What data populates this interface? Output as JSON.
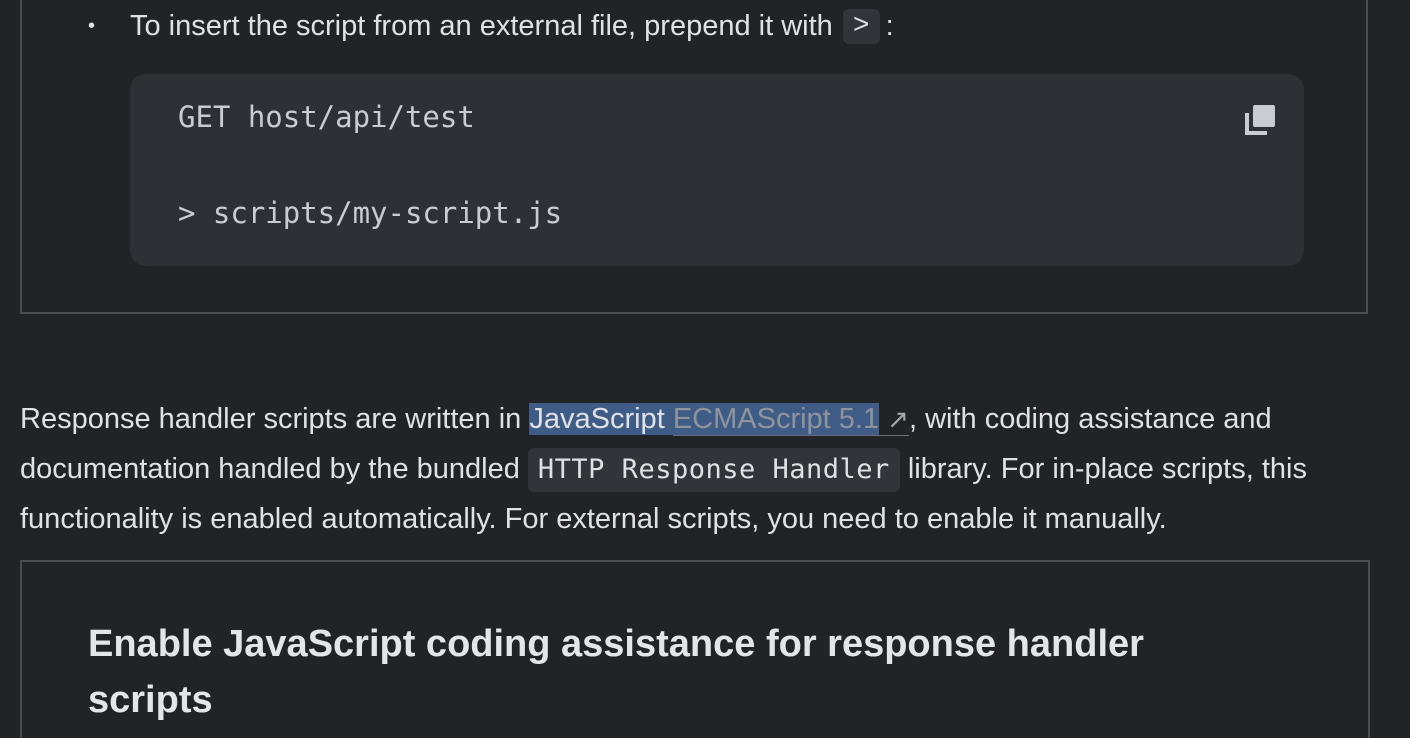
{
  "bullet": {
    "text_before": "To insert the script from an external file, prepend it with",
    "code": ">",
    "text_after": ":"
  },
  "code_block": {
    "lines": [
      "GET host/api/test",
      "> scripts/my-script.js"
    ]
  },
  "paragraph": {
    "text_1": "Response handler scripts are written in ",
    "selected_word": "JavaScript",
    "link_text": "ECMAScript 5.1",
    "link_arrow": "↗",
    "text_2": ", with coding assistance and documentation handled by the bundled ",
    "code": "HTTP Response Handler",
    "text_3": " library. For in-place scripts, this functionality is enabled automatically. For external scripts, you need to enable it manually."
  },
  "section": {
    "heading": "Enable JavaScript coding assistance for response handler scripts"
  },
  "colors": {
    "background": "#222326",
    "selection": "#3f5c86",
    "code_background": "#2e3035"
  }
}
